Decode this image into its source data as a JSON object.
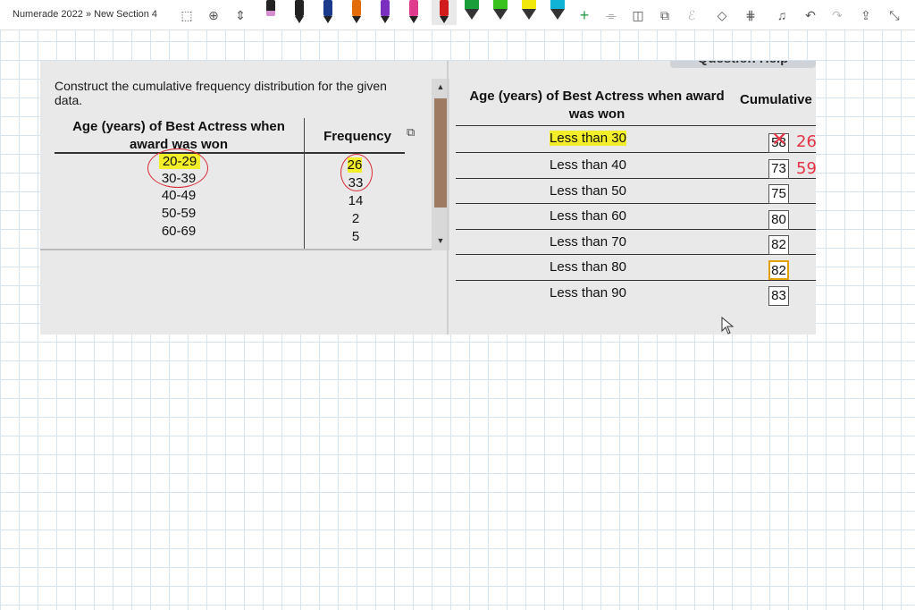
{
  "app": {
    "breadcrumb": "Numerade 2022 » New Section 4"
  },
  "toolbar": {
    "tools": [
      "lasso-select-icon",
      "add-space-icon",
      "insert-space-icon",
      "pen-icon",
      "highlighter-icon",
      "plus-icon",
      "ink-to-shape-icon",
      "ink-to-text-icon",
      "ink-replay-icon",
      "eraser-icon",
      "ruler-icon",
      "math-icon",
      "undo-icon",
      "redo-icon",
      "share-icon",
      "fullscreen-icon"
    ],
    "pen_colors": [
      "#d58fd0",
      "#222222",
      "#1b3a8c",
      "#e36c0a",
      "#7b2fbf",
      "#e03a8c",
      "#d01c1c"
    ],
    "highlighter_colors": [
      "#1a9e3a",
      "#39c11d",
      "#f1e90e",
      "#10b3d6"
    ]
  },
  "question": {
    "text": "Construct the cumulative frequency distribution for the given data.",
    "help_label": "Question Help"
  },
  "given_table": {
    "headers": [
      "Age (years) of Best Actress when award was won",
      "Frequency"
    ],
    "rows": [
      {
        "age": "20-29",
        "frequency": "26"
      },
      {
        "age": "30-39",
        "frequency": "33"
      },
      {
        "age": "40-49",
        "frequency": "14"
      },
      {
        "age": "50-59",
        "frequency": "2"
      },
      {
        "age": "60-69",
        "frequency": "5"
      }
    ]
  },
  "answer_table": {
    "headers": [
      "Age (years) of Best Actress when award was won",
      "Cumulative Frequency"
    ],
    "rows": [
      {
        "label": "Less than 30",
        "value": "58"
      },
      {
        "label": "Less than 40",
        "value": "73"
      },
      {
        "label": "Less than 50",
        "value": "75"
      },
      {
        "label": "Less than 60",
        "value": "80"
      },
      {
        "label": "Less than 70",
        "value": "82"
      },
      {
        "label": "Less than 80",
        "value": "82"
      },
      {
        "label": "Less than 90",
        "value": "83"
      }
    ]
  },
  "annotations": {
    "correction_1": "26",
    "correction_2": "59"
  },
  "colors": {
    "highlight": "#f2ef2a",
    "ink_red": "#e53245",
    "active_box": "#e0a000"
  }
}
